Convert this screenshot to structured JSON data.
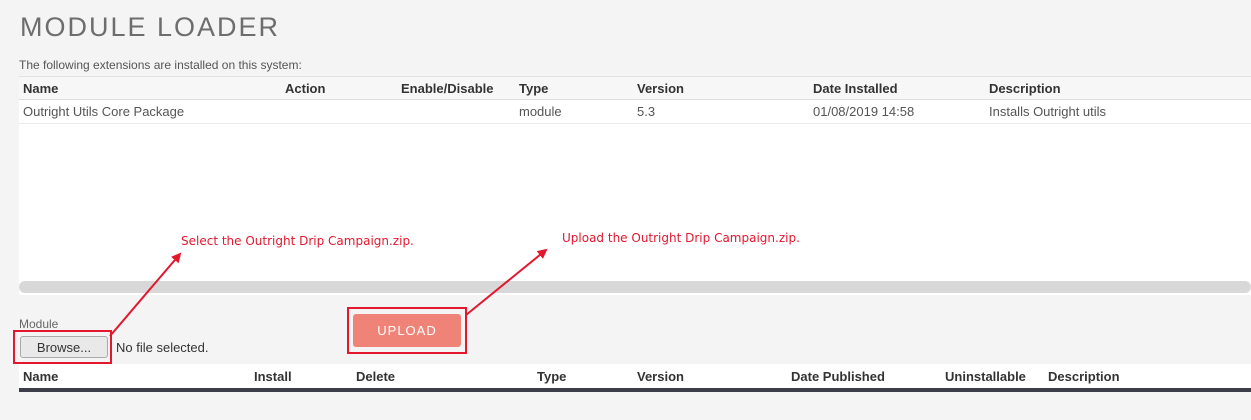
{
  "page": {
    "title": "MODULE LOADER",
    "subtitle": "The following extensions are installed on this system:"
  },
  "installed": {
    "columns": [
      "Name",
      "Action",
      "Enable/Disable",
      "Type",
      "Version",
      "Date Installed",
      "Description"
    ],
    "rows": [
      [
        "Outright Utils Core Package",
        "",
        "",
        "module",
        "5.3",
        "01/08/2019 14:58",
        "Installs Outright utils"
      ]
    ]
  },
  "upload_form": {
    "module_label": "Module",
    "browse_label": "Browse...",
    "file_status": "No file selected.",
    "upload_label": "UPLOAD"
  },
  "available": {
    "columns": [
      "Name",
      "Install",
      "Delete",
      "Type",
      "Version",
      "Date Published",
      "Uninstallable",
      "Description"
    ]
  },
  "annotations": {
    "select_note": "Select the Outright Drip Campaign.zip.",
    "upload_note": "Upload the Outright Drip Campaign.zip."
  },
  "colors": {
    "annotation": "#e3182f",
    "upload_button": "#f08377"
  }
}
